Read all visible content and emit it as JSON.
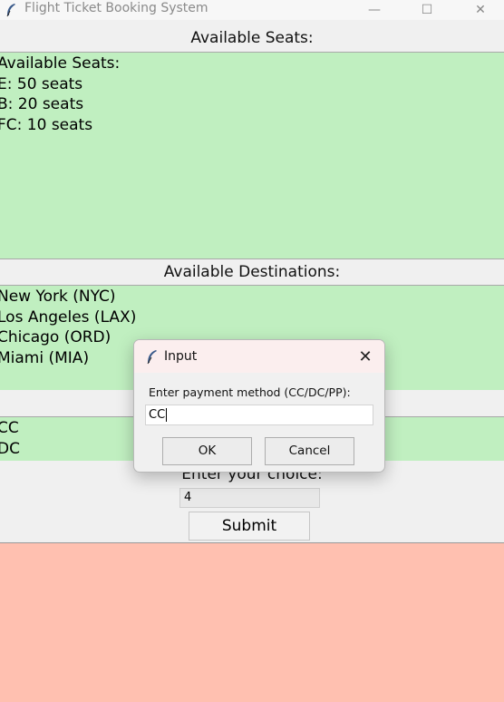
{
  "window": {
    "title": "Flight Ticket Booking System",
    "controls": [
      "—",
      "☐",
      "✕"
    ]
  },
  "seats": {
    "heading": "Available Seats:",
    "lines": [
      "Available Seats:",
      "E: 50 seats",
      "B: 20 seats",
      "FC: 10 seats"
    ]
  },
  "destinations": {
    "heading": "Available Destinations:",
    "lines": [
      "New York (NYC)",
      "Los Angeles (LAX)",
      "Chicago (ORD)",
      "Miami (MIA)"
    ]
  },
  "payment": {
    "lines": [
      "CC",
      "DC"
    ]
  },
  "choice": {
    "label": "Enter your choice:",
    "value": "4"
  },
  "submit": {
    "label": "Submit"
  },
  "dialog": {
    "title": "Input",
    "prompt": "Enter payment method (CC/DC/PP):",
    "value": "CC",
    "ok_label": "OK",
    "cancel_label": "Cancel",
    "close_glyph": "✕"
  },
  "colors": {
    "list_bg": "#c0efc0",
    "output_bg": "#ffc0b0",
    "dialog_titlebar_bg": "#fbeeee"
  }
}
